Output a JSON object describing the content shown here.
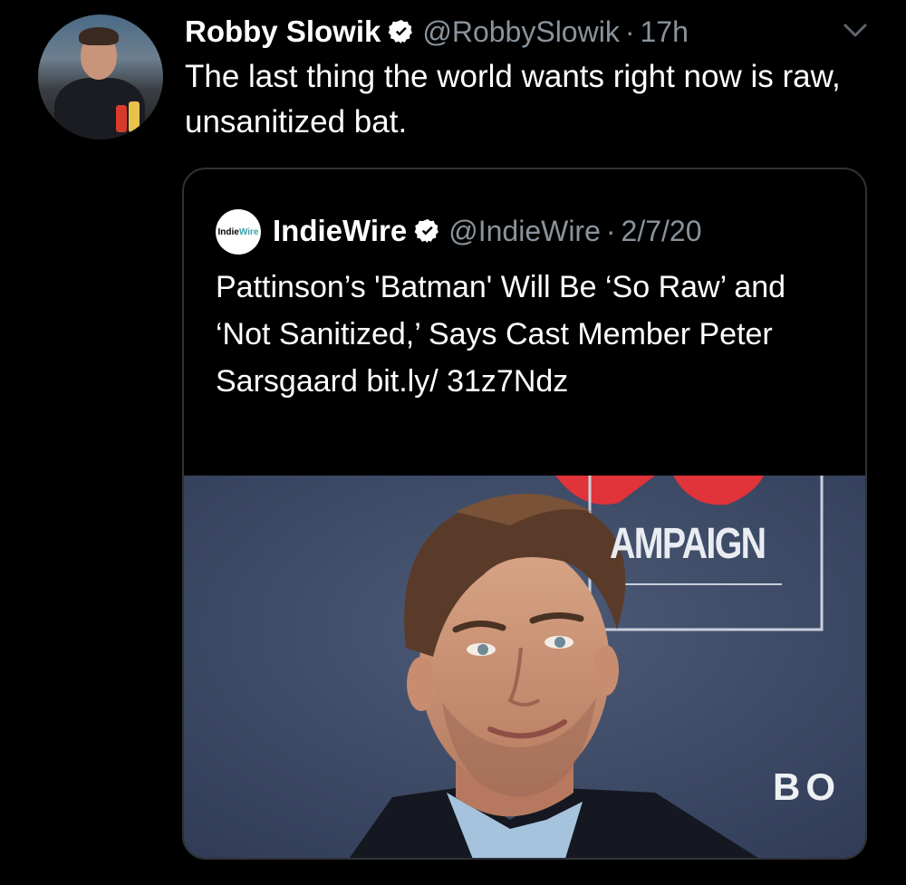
{
  "tweet": {
    "author_name": "Robby Slowik",
    "author_handle": "@RobbySlowik",
    "separator": "·",
    "time": "17h",
    "text": "The last thing the world wants right now is raw, unsanitized bat.",
    "verified": true
  },
  "quoted": {
    "logo_text_a": "Indie",
    "logo_text_b": "Wire",
    "author_name": "IndieWire",
    "author_handle": "@IndieWire",
    "separator": "·",
    "date": "2/7/20",
    "text": "Pattinson’s 'Batman' Will Be ‘So Raw’ and ‘Not Sanitized,’ Says Cast Member Peter Sarsgaard bit.ly/ 31z7Ndz",
    "verified": true
  },
  "photo": {
    "backdrop_text_1": "AMPAIGN",
    "backdrop_text_2": "BO"
  },
  "icons": {
    "verified": "verified-badge-icon",
    "more": "chevron-down-icon"
  },
  "colors": {
    "background": "#000000",
    "text": "#ffffff",
    "secondary": "#8a939c",
    "border": "#2f3336"
  }
}
